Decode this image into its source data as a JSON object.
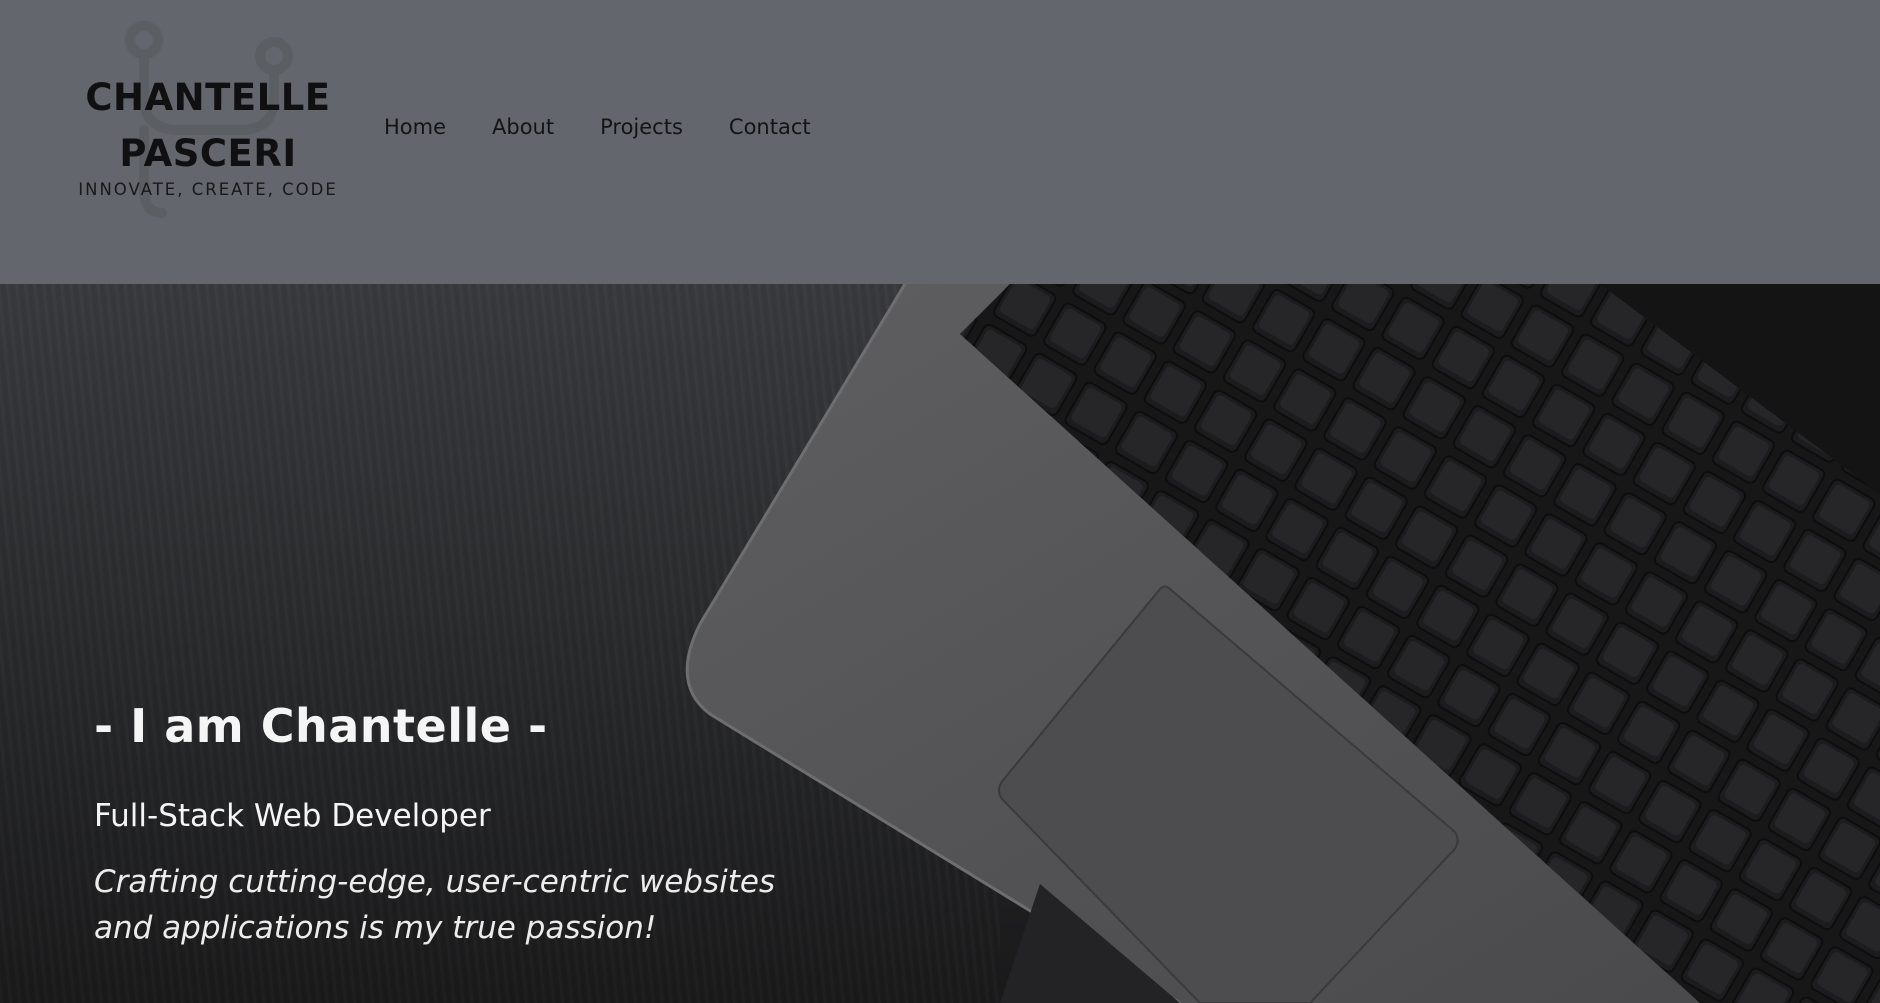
{
  "header": {
    "logo": {
      "name_line1": "CHANTELLE",
      "name_line2": "PASCERI",
      "tagline": "INNOVATE, CREATE, CODE",
      "icon": "circuit-s-icon"
    },
    "nav": [
      {
        "label": "Home"
      },
      {
        "label": "About"
      },
      {
        "label": "Projects"
      },
      {
        "label": "Contact"
      }
    ]
  },
  "hero": {
    "title": "- I am Chantelle -",
    "subtitle": "Full-Stack Web Developer",
    "tagline_line1": "Crafting cutting-edge, user-centric websites",
    "tagline_line2": "and applications is my true passion!",
    "background_image": "laptop-keyboard-on-dark-wood-desk"
  },
  "colors": {
    "header_bg": "#63666c",
    "logo_text": "#101012",
    "hero_text": "#f5f5f5"
  }
}
